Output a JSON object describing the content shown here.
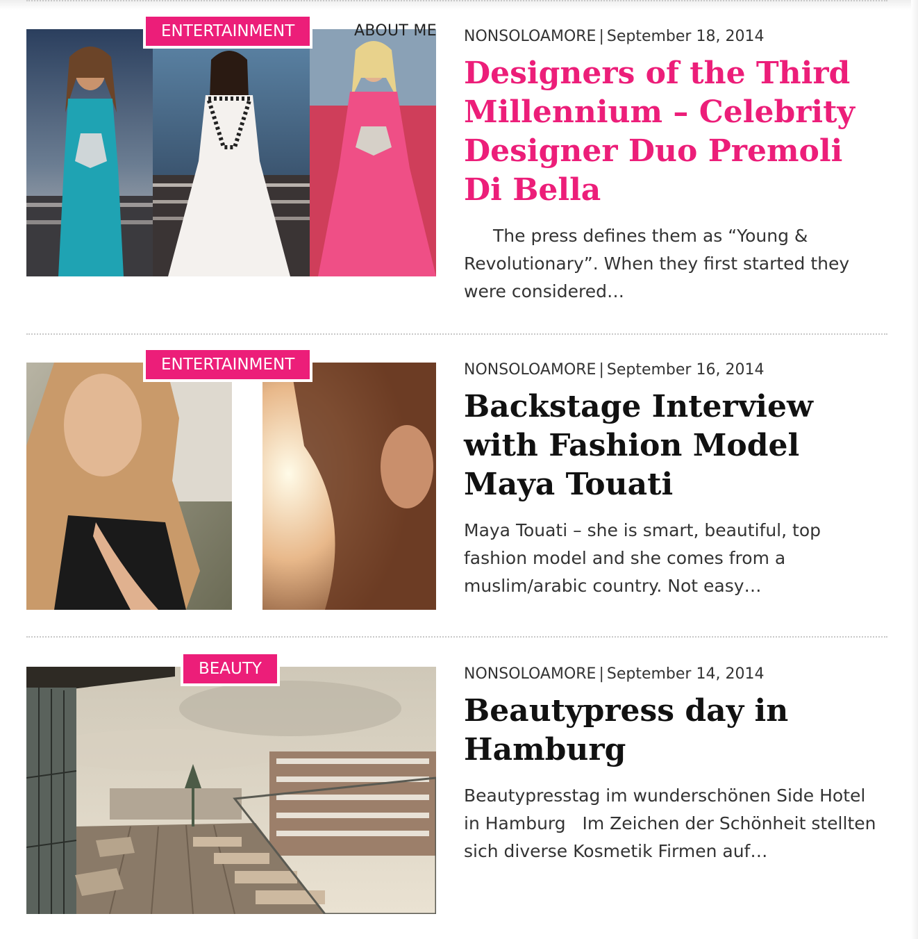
{
  "nav": {
    "about_label": "ABOUT ME"
  },
  "colors": {
    "accent": "#ec1e79",
    "title_dark": "#111111",
    "text": "#333333"
  },
  "posts": [
    {
      "category": "ENTERTAINMENT",
      "author": "NONSOLOAMORE",
      "separator": "|",
      "date": "September 18, 2014",
      "title": "Designers of the Third Millennium – Celebrity Designer Duo Premoli Di Bella",
      "excerpt": "The press defines them as “Young & Revolutionary”. When they first started they were considered…",
      "image": "runway-models-photo"
    },
    {
      "category": "ENTERTAINMENT",
      "author": "NONSOLOAMORE",
      "separator": "|",
      "date": "September 16, 2014",
      "title": "Backstage Interview with Fashion Model Maya Touati",
      "excerpt": "Maya Touati – she is smart, beautiful, top fashion model and she comes from a muslim/arabic country. Not easy…",
      "image": "model-portrait-photo"
    },
    {
      "category": "BEAUTY",
      "author": "NONSOLOAMORE",
      "separator": "|",
      "date": "September 14, 2014",
      "title": "Beautypress day in Hamburg",
      "excerpt": "Beautypresstag im wunderschönen Side Hotel in Hamburg   Im Zeichen der Schönheit stellten sich diverse Kosmetik Firmen auf…",
      "image": "hotel-terrace-photo"
    }
  ]
}
